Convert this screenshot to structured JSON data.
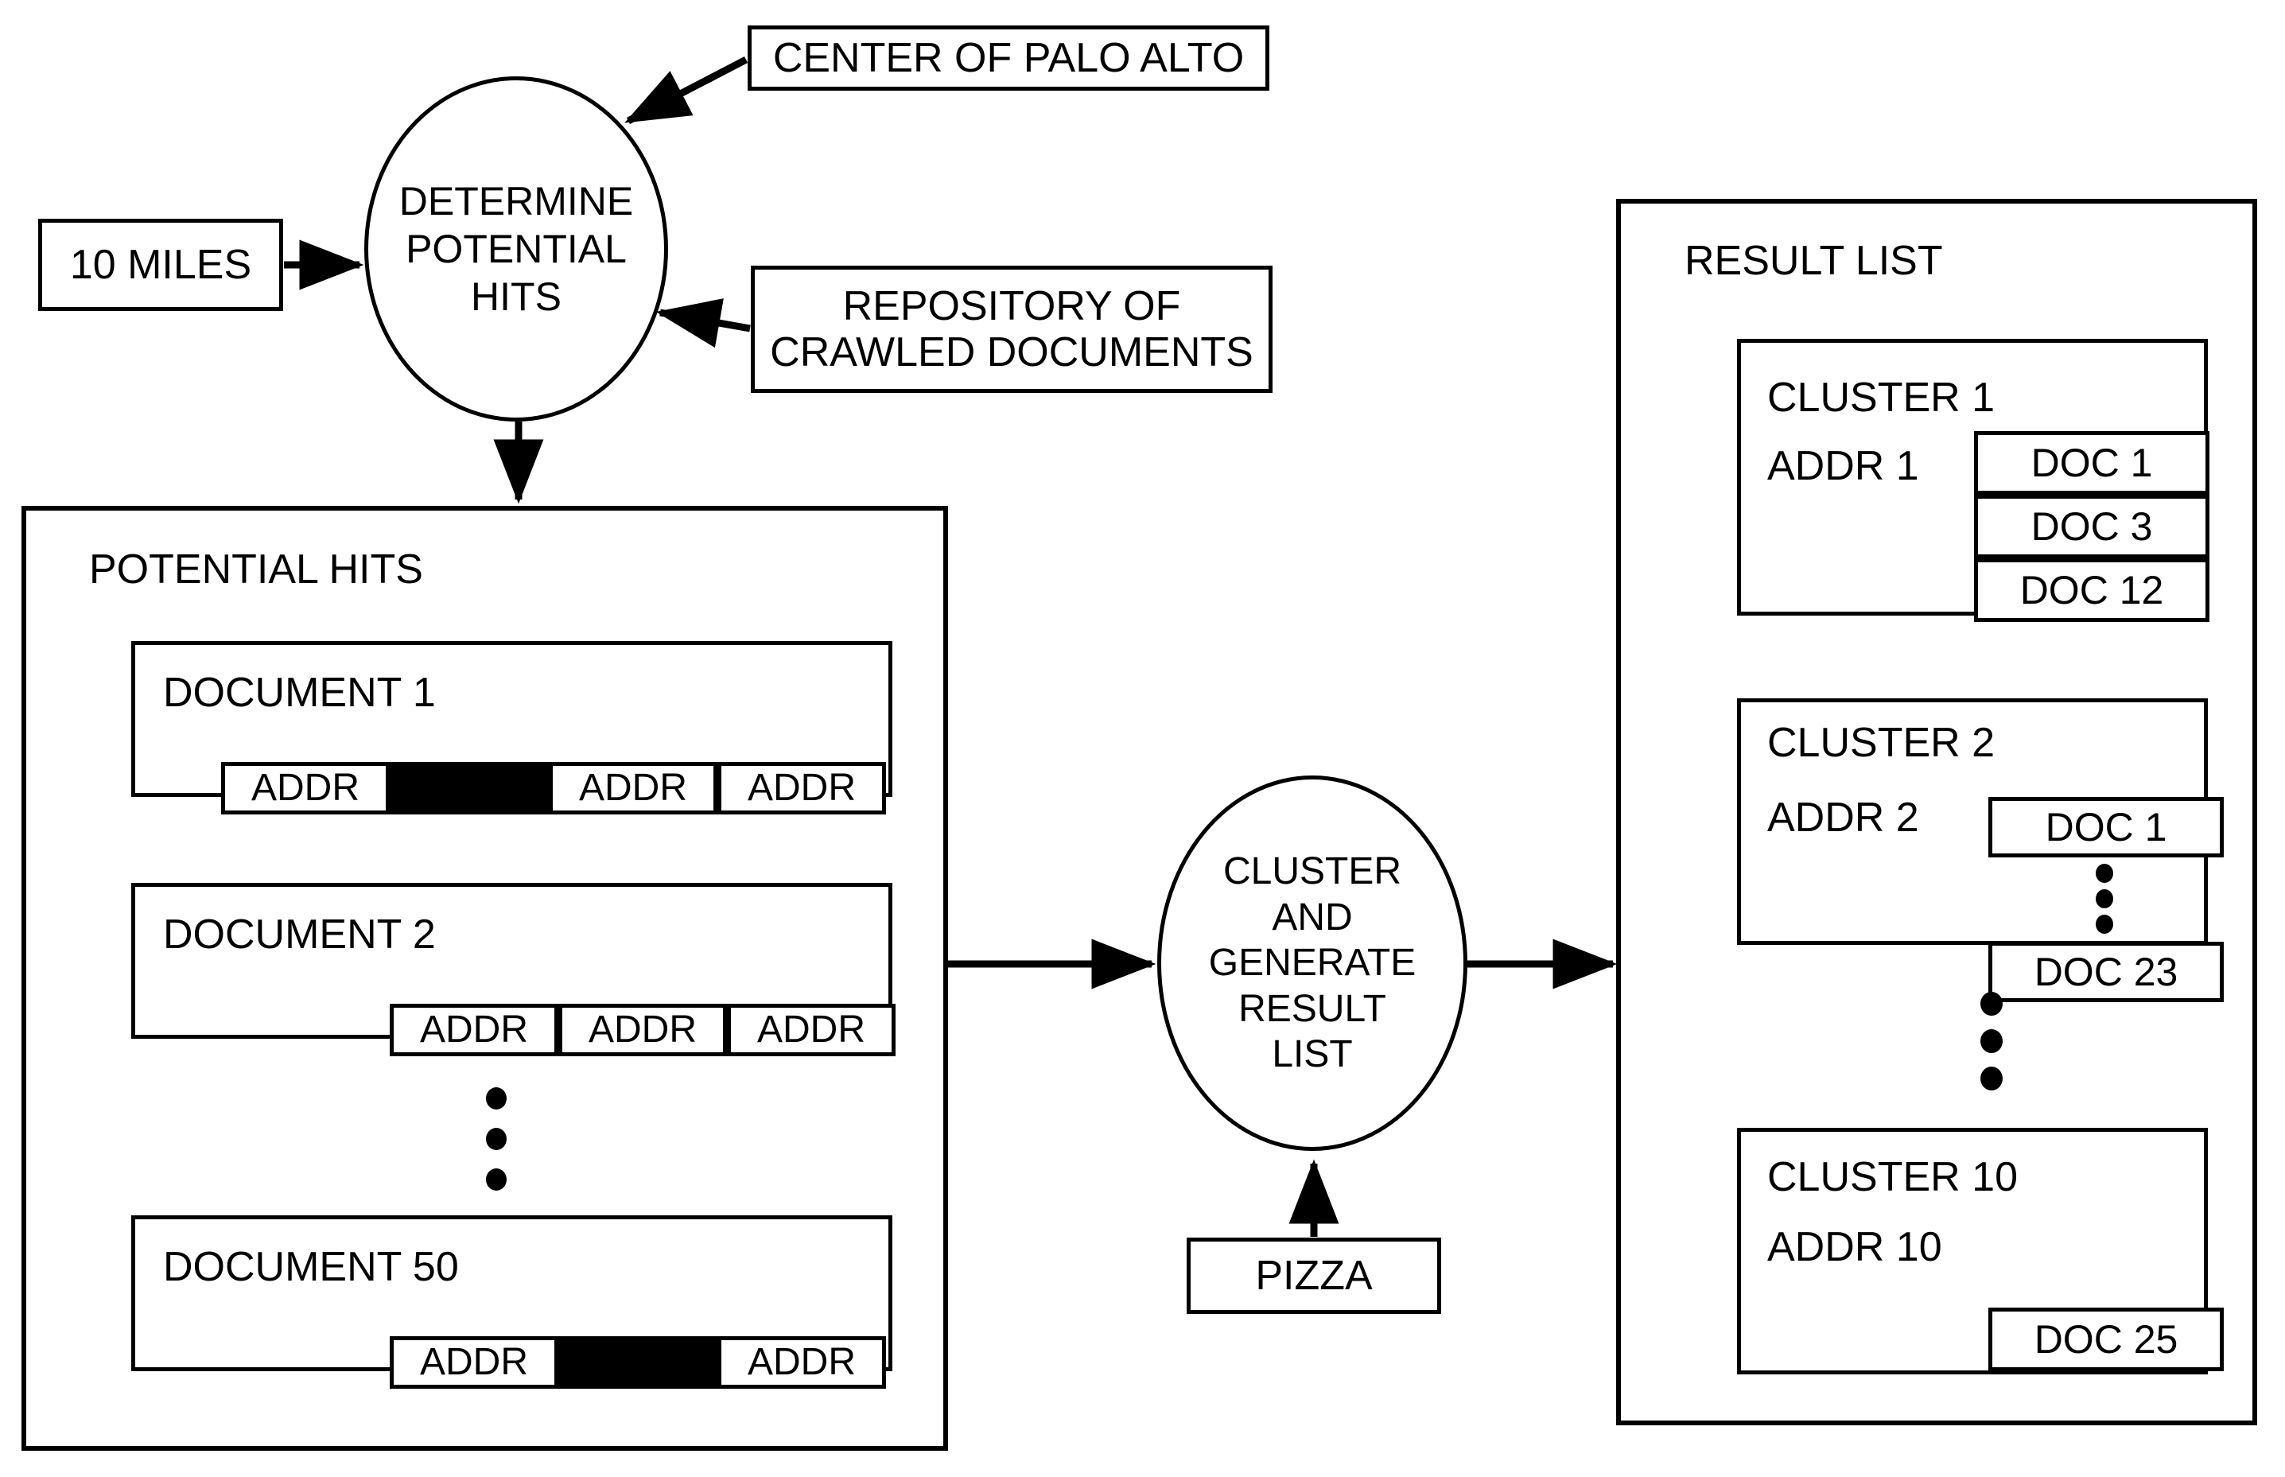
{
  "figure": {
    "kind": "patent-flow-diagram",
    "background_color": "#ffffff",
    "line_color": "#000000"
  },
  "inputs": {
    "distance_box": "10 MILES",
    "center_box": "CENTER OF PALO ALTO",
    "repository_box_line1": "REPOSITORY OF",
    "repository_box_line2": "CRAWLED DOCUMENTS",
    "query_box": "PIZZA"
  },
  "process_nodes": {
    "determine": {
      "line1": "DETERMINE",
      "line2": "POTENTIAL",
      "line3": "HITS"
    },
    "cluster": {
      "line1": "CLUSTER",
      "line2": "AND",
      "line3": "GENERATE",
      "line4": "RESULT",
      "line5": "LIST"
    }
  },
  "potential_hits": {
    "title": "POTENTIAL HITS",
    "documents": [
      {
        "title": "DOCUMENT 1",
        "cells": [
          {
            "kind": "addr",
            "label": "ADDR"
          },
          {
            "kind": "black",
            "label": ""
          },
          {
            "kind": "addr",
            "label": "ADDR"
          },
          {
            "kind": "addr",
            "label": "ADDR"
          }
        ]
      },
      {
        "title": "DOCUMENT 2",
        "cells": [
          {
            "kind": "addr",
            "label": "ADDR"
          },
          {
            "kind": "addr",
            "label": "ADDR"
          },
          {
            "kind": "addr",
            "label": "ADDR"
          }
        ]
      },
      {
        "title": "DOCUMENT 50",
        "cells": [
          {
            "kind": "addr",
            "label": "ADDR"
          },
          {
            "kind": "black",
            "label": ""
          },
          {
            "kind": "addr",
            "label": "ADDR"
          }
        ]
      }
    ],
    "ellipsis": "vertical-three-dots"
  },
  "result_list": {
    "title": "RESULT LIST",
    "clusters": [
      {
        "name": "CLUSTER 1",
        "addr": "ADDR 1",
        "docs": [
          "DOC 1",
          "DOC 3",
          "DOC 12"
        ],
        "inner_ellipsis": false
      },
      {
        "name": "CLUSTER 2",
        "addr": "ADDR 2",
        "docs": [
          "DOC 1",
          "DOC 23"
        ],
        "inner_ellipsis": true
      },
      {
        "name": "CLUSTER 10",
        "addr": "ADDR 10",
        "docs": [
          "DOC 25"
        ],
        "inner_ellipsis": false
      }
    ],
    "ellipsis": "vertical-three-dots"
  },
  "arrows": [
    {
      "name": "ten-miles-to-determine",
      "from": "10 MILES",
      "to": "DETERMINE POTENTIAL HITS"
    },
    {
      "name": "center-to-determine",
      "from": "CENTER OF PALO ALTO",
      "to": "DETERMINE POTENTIAL HITS"
    },
    {
      "name": "repository-to-determine",
      "from": "REPOSITORY OF CRAWLED DOCUMENTS",
      "to": "DETERMINE POTENTIAL HITS"
    },
    {
      "name": "determine-to-potential-hits",
      "from": "DETERMINE POTENTIAL HITS",
      "to": "POTENTIAL HITS"
    },
    {
      "name": "potential-hits-to-cluster",
      "from": "POTENTIAL HITS",
      "to": "CLUSTER AND GENERATE RESULT LIST"
    },
    {
      "name": "pizza-to-cluster",
      "from": "PIZZA",
      "to": "CLUSTER AND GENERATE RESULT LIST"
    },
    {
      "name": "cluster-to-result-list",
      "from": "CLUSTER AND GENERATE RESULT LIST",
      "to": "RESULT LIST"
    }
  ]
}
